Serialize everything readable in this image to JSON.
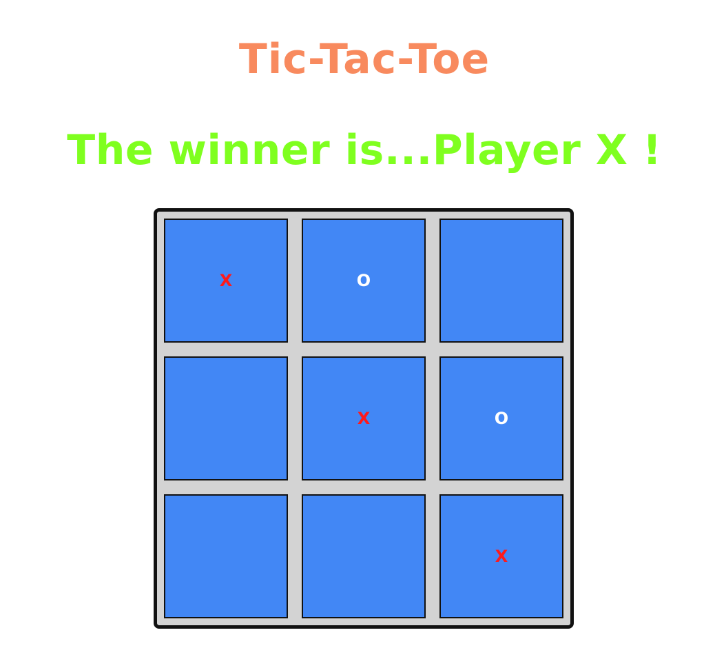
{
  "title": {
    "text": "Tic-Tac-Toe",
    "color": "#f88a5e"
  },
  "status": {
    "text": "The winner is...Player X !",
    "color": "#7fff1f"
  },
  "board": {
    "background": "#d3d3d3",
    "cell_color": "#4287f5",
    "mark_colors": {
      "X": "#ff1a1a",
      "O": "#ffffff"
    },
    "cells": [
      {
        "id": "r1c1",
        "mark": "X"
      },
      {
        "id": "r1c2",
        "mark": "O"
      },
      {
        "id": "r1c3",
        "mark": ""
      },
      {
        "id": "r2c1",
        "mark": ""
      },
      {
        "id": "r2c2",
        "mark": "X"
      },
      {
        "id": "r2c3",
        "mark": "O"
      },
      {
        "id": "r3c1",
        "mark": ""
      },
      {
        "id": "r3c2",
        "mark": ""
      },
      {
        "id": "r3c3",
        "mark": "X"
      }
    ]
  }
}
